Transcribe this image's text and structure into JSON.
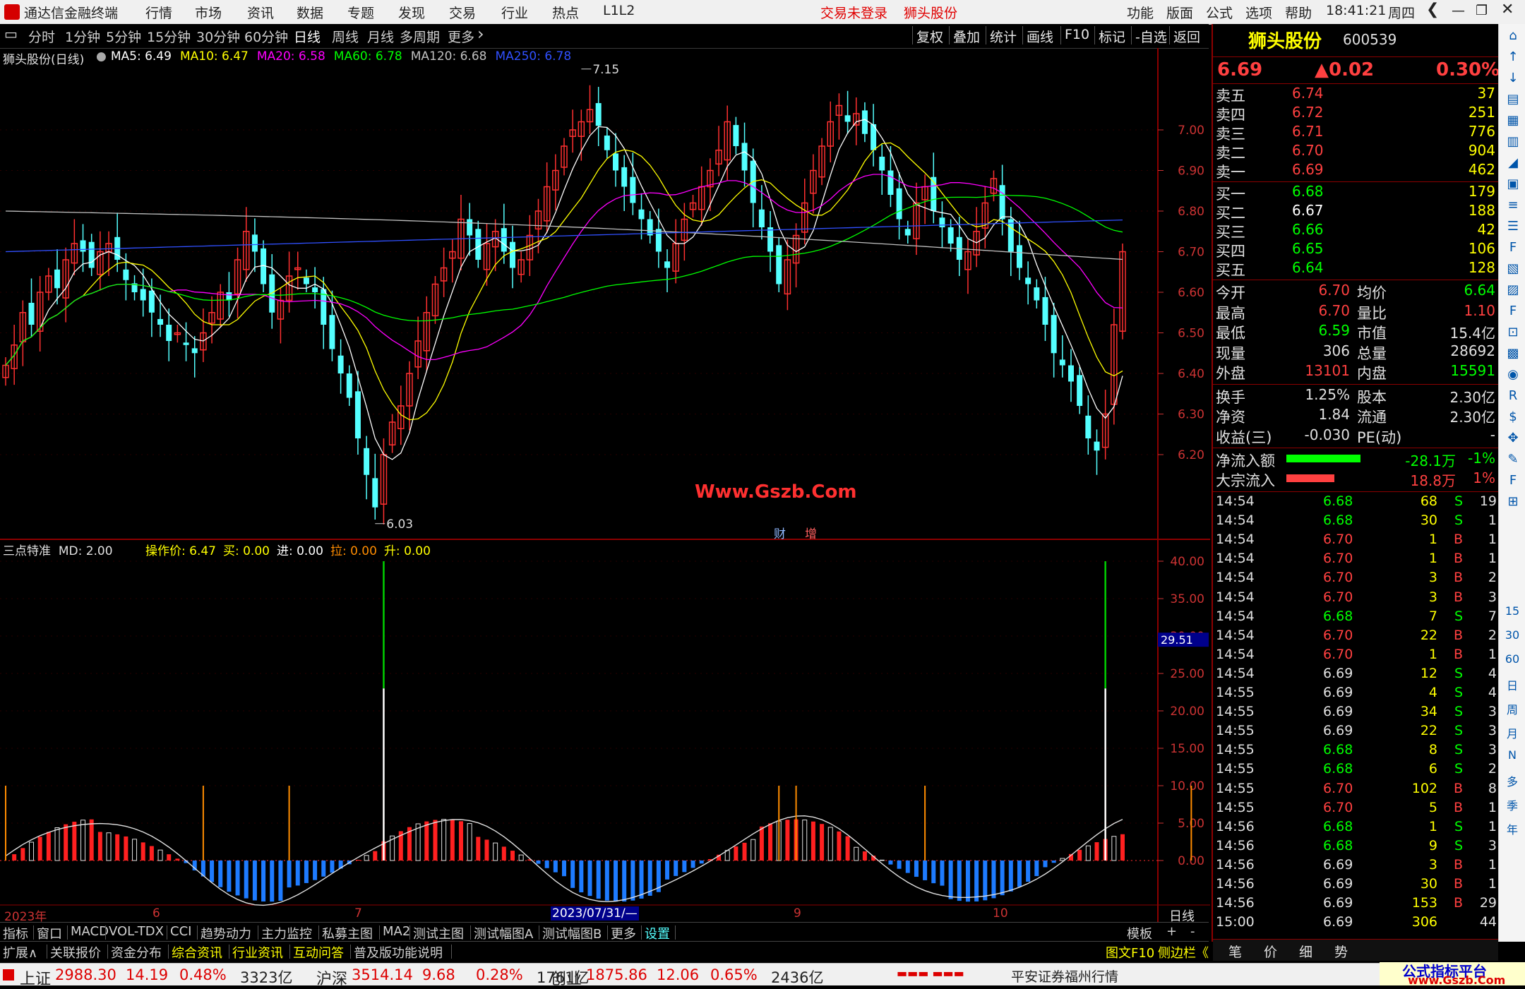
{
  "titlebar": {
    "app_name": "通达信金融终端",
    "menu": [
      "行情",
      "市场",
      "资讯",
      "数据",
      "专题",
      "发现",
      "交易",
      "行业",
      "热点",
      "L1L2"
    ],
    "login_status": "交易未登录",
    "stock_name": "狮头股份",
    "right_menu": [
      "功能",
      "版面",
      "公式",
      "选项",
      "帮助"
    ],
    "time": "18:41:21",
    "weekday": "周四"
  },
  "toolbar": {
    "periods": [
      "分时",
      "1分钟",
      "5分钟",
      "15分钟",
      "30分钟",
      "60分钟",
      "日线",
      "周线",
      "月线",
      "多周期",
      "更多"
    ],
    "active_period": "日线",
    "right_buttons": [
      "复权",
      "叠加",
      "统计",
      "画线",
      "F10",
      "标记",
      "-自选",
      "返回"
    ]
  },
  "main_chart": {
    "title": "狮头股份(日线)",
    "ma": [
      {
        "label": "MA5: 6.49",
        "color": "#ffffff"
      },
      {
        "label": "MA10: 6.47",
        "color": "#ffff00"
      },
      {
        "label": "MA20: 6.58",
        "color": "#ff00ff"
      },
      {
        "label": "MA60: 6.78",
        "color": "#00ff00"
      },
      {
        "label": "MA120: 6.68",
        "color": "#c0c0c0"
      },
      {
        "label": "MA250: 6.78",
        "color": "#3050ff"
      }
    ],
    "y_ticks": [
      "7.00",
      "6.90",
      "6.80",
      "6.70",
      "6.60",
      "6.50",
      "6.40",
      "6.30",
      "6.20"
    ],
    "high_marker": "7.15",
    "low_marker": "6.03",
    "watermark": "Www.Gszb.Com",
    "badges": [
      "财",
      "增"
    ]
  },
  "indicator": {
    "title": "三点特准",
    "md": "MD: 2.00",
    "values": [
      {
        "label": "操作价: 6.47",
        "color": "#ffff00"
      },
      {
        "label": "买: 0.00",
        "color": "#ffff00"
      },
      {
        "label": "进: 0.00",
        "color": "#ffffff"
      },
      {
        "label": "拉: 0.00",
        "color": "#ff8c00"
      },
      {
        "label": "升: 0.00",
        "color": "#ffff00"
      }
    ],
    "y_ticks": [
      "40.00",
      "35.00",
      "30.00",
      "25.00",
      "20.00",
      "15.00",
      "10.00",
      "5.00",
      "0.00"
    ],
    "cursor_value": "29.51"
  },
  "x_axis": [
    "2023年",
    "6",
    "7",
    "2023/07/31/—",
    "9",
    "10"
  ],
  "x_axis_right": "日线",
  "tabs1": [
    "指标",
    "窗口",
    "MACD",
    "VOL-TDX",
    "CCI",
    "趋势动力",
    "主力监控",
    "私募主图",
    "MA2",
    "测试主图",
    "测试幅图A",
    "测试幅图B",
    "更多",
    "设置"
  ],
  "tabs1_right": [
    "模板",
    "+",
    "-"
  ],
  "tabs2": [
    "扩展∧",
    "关联报价",
    "资金分布",
    "综合资讯",
    "行业资讯",
    "互动问答",
    "普及版功能说明"
  ],
  "tabs2_right": [
    "图文F10",
    "侧边栏《"
  ],
  "quote": {
    "name": "狮头股份",
    "code": "600539",
    "price": "6.69",
    "change": "▲0.02",
    "pct": "0.30%",
    "asks": [
      {
        "label": "卖五",
        "price": "6.74",
        "vol": "37"
      },
      {
        "label": "卖四",
        "price": "6.72",
        "vol": "251"
      },
      {
        "label": "卖三",
        "price": "6.71",
        "vol": "776"
      },
      {
        "label": "卖二",
        "price": "6.70",
        "vol": "904"
      },
      {
        "label": "卖一",
        "price": "6.69",
        "vol": "462"
      }
    ],
    "bids": [
      {
        "label": "买一",
        "price": "6.68",
        "vol": "179",
        "color": "#00ff00"
      },
      {
        "label": "买二",
        "price": "6.67",
        "vol": "188",
        "color": "#ffffff"
      },
      {
        "label": "买三",
        "price": "6.66",
        "vol": "42",
        "color": "#00ff00"
      },
      {
        "label": "买四",
        "price": "6.65",
        "vol": "106",
        "color": "#00ff00"
      },
      {
        "label": "买五",
        "price": "6.64",
        "vol": "128",
        "color": "#00ff00"
      }
    ],
    "stats": [
      {
        "l1": "今开",
        "v1": "6.70",
        "c1": "#ff4040",
        "l2": "均价",
        "v2": "6.64",
        "c2": "#00ff00"
      },
      {
        "l1": "最高",
        "v1": "6.70",
        "c1": "#ff4040",
        "l2": "量比",
        "v2": "1.10",
        "c2": "#ff4040"
      },
      {
        "l1": "最低",
        "v1": "6.59",
        "c1": "#00ff00",
        "l2": "市值",
        "v2": "15.4亿",
        "c2": "#e0e0e0"
      },
      {
        "l1": "现量",
        "v1": "306",
        "c1": "#e0e0e0",
        "l2": "总量",
        "v2": "28692",
        "c2": "#e0e0e0"
      },
      {
        "l1": "外盘",
        "v1": "13101",
        "c1": "#ff4040",
        "l2": "内盘",
        "v2": "15591",
        "c2": "#00ff00"
      }
    ],
    "stats2": [
      {
        "l1": "换手",
        "v1": "1.25%",
        "l2": "股本",
        "v2": "2.30亿"
      },
      {
        "l1": "净资",
        "v1": "1.84",
        "l2": "流通",
        "v2": "2.30亿"
      },
      {
        "l1": "收益(三)",
        "v1": "-0.030",
        "l2": "PE(动)",
        "v2": "-"
      }
    ],
    "flows": [
      {
        "label": "净流入额",
        "value": "-28.1万",
        "pct": "-1%",
        "color": "#00ff00",
        "bar": 0.62
      },
      {
        "label": "大宗流入",
        "value": "18.8万",
        "pct": "1%",
        "color": "#ff4040",
        "bar": 0.4
      }
    ],
    "ticks": [
      {
        "t": "14:54",
        "p": "6.68",
        "v": "68",
        "s": "S",
        "n": "19"
      },
      {
        "t": "14:54",
        "p": "6.68",
        "v": "30",
        "s": "S",
        "n": "1"
      },
      {
        "t": "14:54",
        "p": "6.70",
        "v": "1",
        "s": "B",
        "n": "1"
      },
      {
        "t": "14:54",
        "p": "6.70",
        "v": "1",
        "s": "B",
        "n": "1"
      },
      {
        "t": "14:54",
        "p": "6.70",
        "v": "3",
        "s": "B",
        "n": "2"
      },
      {
        "t": "14:54",
        "p": "6.70",
        "v": "3",
        "s": "B",
        "n": "3"
      },
      {
        "t": "14:54",
        "p": "6.68",
        "v": "7",
        "s": "S",
        "n": "7"
      },
      {
        "t": "14:54",
        "p": "6.70",
        "v": "22",
        "s": "B",
        "n": "2"
      },
      {
        "t": "14:54",
        "p": "6.70",
        "v": "1",
        "s": "B",
        "n": "1"
      },
      {
        "t": "14:54",
        "p": "6.69",
        "v": "12",
        "s": "S",
        "n": "4"
      },
      {
        "t": "14:55",
        "p": "6.69",
        "v": "4",
        "s": "S",
        "n": "4"
      },
      {
        "t": "14:55",
        "p": "6.69",
        "v": "34",
        "s": "S",
        "n": "3"
      },
      {
        "t": "14:55",
        "p": "6.69",
        "v": "22",
        "s": "S",
        "n": "3"
      },
      {
        "t": "14:55",
        "p": "6.68",
        "v": "8",
        "s": "S",
        "n": "3"
      },
      {
        "t": "14:55",
        "p": "6.68",
        "v": "6",
        "s": "S",
        "n": "2"
      },
      {
        "t": "14:55",
        "p": "6.70",
        "v": "102",
        "s": "B",
        "n": "8"
      },
      {
        "t": "14:55",
        "p": "6.70",
        "v": "5",
        "s": "B",
        "n": "1"
      },
      {
        "t": "14:56",
        "p": "6.68",
        "v": "1",
        "s": "S",
        "n": "1"
      },
      {
        "t": "14:56",
        "p": "6.68",
        "v": "9",
        "s": "S",
        "n": "3"
      },
      {
        "t": "14:56",
        "p": "6.69",
        "v": "3",
        "s": "B",
        "n": "1"
      },
      {
        "t": "14:56",
        "p": "6.69",
        "v": "30",
        "s": "B",
        "n": "1"
      },
      {
        "t": "14:56",
        "p": "6.69",
        "v": "153",
        "s": "B",
        "n": "29"
      },
      {
        "t": "15:00",
        "p": "6.69",
        "v": "306",
        "s": "",
        "n": "44"
      }
    ],
    "bottom_tabs": [
      "笔",
      "价",
      "细",
      "势"
    ]
  },
  "sidebar_labels": [
    "15",
    "30",
    "60",
    "日",
    "周",
    "月",
    "N",
    "多",
    "季",
    "年"
  ],
  "statusbar": {
    "items": [
      {
        "name": "上证",
        "price": "2988.30",
        "chg": "14.19",
        "pct": "0.48%",
        "amt": "3323亿"
      },
      {
        "name": "沪深",
        "price": "3514.14",
        "chg": "9.68",
        "pct": "0.28%",
        "amt": "1761亿"
      },
      {
        "name": "创业",
        "price": "1875.86",
        "chg": "12.06",
        "pct": "0.65%",
        "amt": "2436亿"
      }
    ],
    "broker": "平安证券福州行情",
    "logo": "公式指标平台",
    "logo_url": "www.Gszb.Com"
  }
}
